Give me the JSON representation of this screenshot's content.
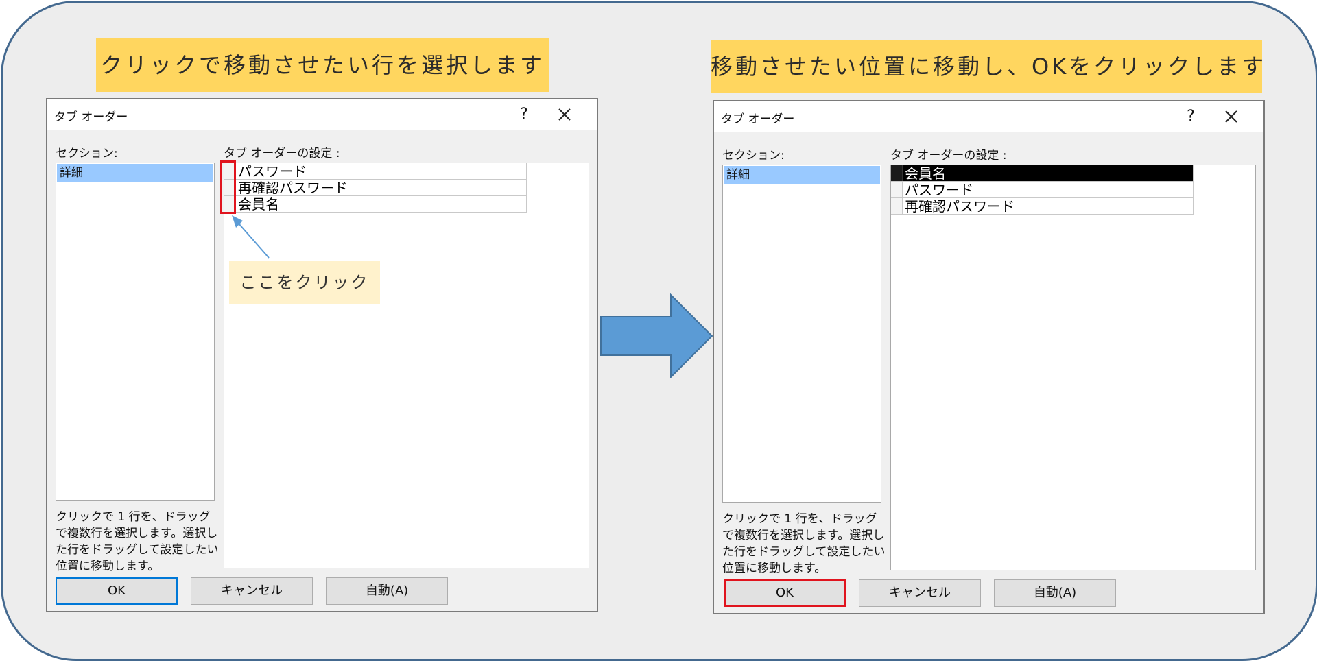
{
  "banners": {
    "left": "クリックで移動させたい行を選択します",
    "right": "移動させたい位置に移動し、OKをクリックします"
  },
  "callout": {
    "text": "ここをクリック"
  },
  "colors": {
    "accent_red": "#e0141e",
    "banner_yellow": "#ffd65f",
    "callout_yellow": "#fff2cc",
    "arrow_blue": "#5b9bd5",
    "frame_border": "#44698f",
    "selection_blue": "#99c9ff"
  },
  "dialog_before": {
    "title": "タブ オーダー",
    "help_label": "?",
    "section_label": "セクション:",
    "sections": [
      "詳細"
    ],
    "order_label": "タブ オーダーの設定 :",
    "rows": [
      "パスワード",
      "再確認パスワード",
      "会員名"
    ],
    "help_text": "クリックで 1 行を、ドラッグで複数行を選択します。選択した行をドラッグして設定したい位置に移動します。",
    "buttons": {
      "ok": "OK",
      "cancel": "キャンセル",
      "auto": "自動(A)"
    }
  },
  "dialog_after": {
    "title": "タブ オーダー",
    "help_label": "?",
    "section_label": "セクション:",
    "sections": [
      "詳細"
    ],
    "order_label": "タブ オーダーの設定 :",
    "rows": [
      "会員名",
      "パスワード",
      "再確認パスワード"
    ],
    "selected_row": "会員名",
    "help_text": "クリックで 1 行を、ドラッグで複数行を選択します。選択した行をドラッグして設定したい位置に移動します。",
    "buttons": {
      "ok": "OK",
      "cancel": "キャンセル",
      "auto": "自動(A)"
    }
  },
  "icons": {
    "close": "close-icon",
    "arrow": "right-arrow-icon"
  }
}
